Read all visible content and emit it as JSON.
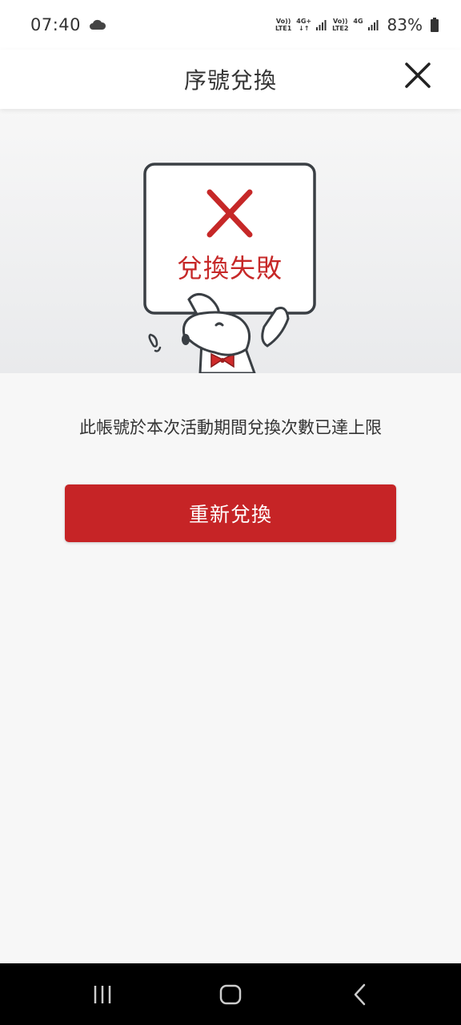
{
  "status_bar": {
    "time": "07:40",
    "sim1_top": "Vo))",
    "sim1_bottom": "LTE1",
    "net1_top": "4G+",
    "net1_bottom": "↓↑",
    "sim2_top": "Vo))",
    "sim2_bottom": "LTE2",
    "net2_top": "4G",
    "battery": "83%",
    "icons": [
      "cloud-icon",
      "signal-icon",
      "signal-icon",
      "battery-icon"
    ]
  },
  "header": {
    "title": "序號兌換",
    "close_icon": "close-icon"
  },
  "illustration": {
    "sign_text": "兌換失敗",
    "icons": [
      "x-mark-icon",
      "dog-mascot"
    ]
  },
  "message": "此帳號於本次活動期間兌換次數已達上限",
  "retry_button": {
    "label": "重新兌換"
  },
  "nav_bar": {
    "icons": [
      "recent-apps-icon",
      "home-icon",
      "back-icon"
    ]
  },
  "colors": {
    "accent": "#c62426",
    "text": "#333333",
    "background": "#f7f7f7"
  }
}
